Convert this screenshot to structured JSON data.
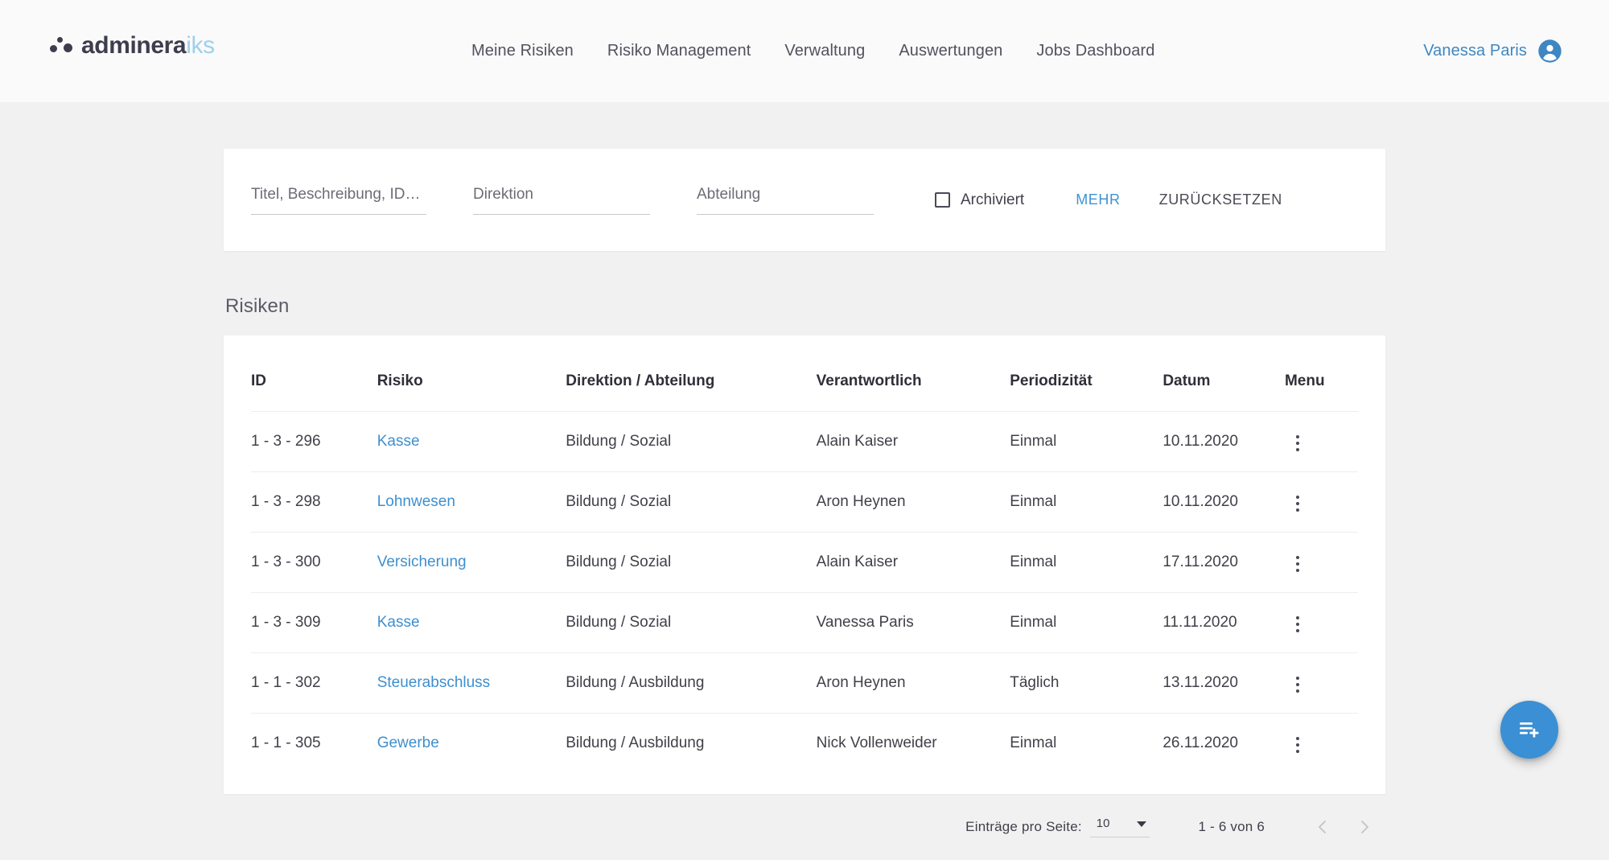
{
  "header": {
    "brand": {
      "primary": "adminera",
      "secondary": "iks",
      "accent_color": "#9ed0ea"
    },
    "nav": [
      {
        "label": "Meine Risiken"
      },
      {
        "label": "Risiko Management"
      },
      {
        "label": "Verwaltung"
      },
      {
        "label": "Auswertungen"
      },
      {
        "label": "Jobs Dashboard"
      }
    ],
    "user": {
      "name": "Vanessa Paris",
      "icon": "account-circle-icon",
      "color": "#3e87c3"
    }
  },
  "filters": {
    "search": {
      "placeholder": "Titel, Beschreibung, ID…",
      "value": ""
    },
    "direktion": {
      "placeholder": "Direktion",
      "value": ""
    },
    "abteilung": {
      "placeholder": "Abteilung",
      "value": ""
    },
    "archived": {
      "label": "Archiviert",
      "checked": false
    },
    "more_label": "MEHR",
    "reset_label": "ZURÜCKSETZEN",
    "more_color": "#3e93d2"
  },
  "section": {
    "title": "Risiken"
  },
  "table": {
    "columns": [
      "ID",
      "Risiko",
      "Direktion / Abteilung",
      "Verantwortlich",
      "Periodizität",
      "Datum",
      "Menu"
    ],
    "rows": [
      {
        "id": "1 - 3 - 296",
        "risiko": "Kasse",
        "direktion": "Bildung / Sozial",
        "verantwortlich": "Alain Kaiser",
        "periodizitaet": "Einmal",
        "datum": "10.11.2020"
      },
      {
        "id": "1 - 3 - 298",
        "risiko": "Lohnwesen",
        "direktion": "Bildung / Sozial",
        "verantwortlich": "Aron Heynen",
        "periodizitaet": "Einmal",
        "datum": "10.11.2020"
      },
      {
        "id": "1 - 3 - 300",
        "risiko": "Versicherung",
        "direktion": "Bildung / Sozial",
        "verantwortlich": "Alain Kaiser",
        "periodizitaet": "Einmal",
        "datum": "17.11.2020"
      },
      {
        "id": "1 - 3 - 309",
        "risiko": "Kasse",
        "direktion": "Bildung / Sozial",
        "verantwortlich": "Vanessa Paris",
        "periodizitaet": "Einmal",
        "datum": "11.11.2020"
      },
      {
        "id": "1 - 1 - 302",
        "risiko": "Steuerabschluss",
        "direktion": "Bildung / Ausbildung",
        "verantwortlich": "Aron Heynen",
        "periodizitaet": "Täglich",
        "datum": "13.11.2020"
      },
      {
        "id": "1 - 1 - 305",
        "risiko": "Gewerbe",
        "direktion": "Bildung / Ausbildung",
        "verantwortlich": "Nick Vollenweider",
        "periodizitaet": "Einmal",
        "datum": "26.11.2020"
      }
    ],
    "link_color": "#3e8fce",
    "row_menu_icon": "kebab-menu-icon"
  },
  "paginator": {
    "items_per_page_label": "Einträge pro Seite:",
    "items_per_page_value": "10",
    "range_label": "1 - 6 von 6",
    "prev_icon": "chevron-left-icon",
    "next_icon": "chevron-right-icon",
    "prev_disabled": true,
    "next_disabled": true
  },
  "fab": {
    "icon": "playlist-add-icon",
    "color": "#3b8fd4"
  }
}
